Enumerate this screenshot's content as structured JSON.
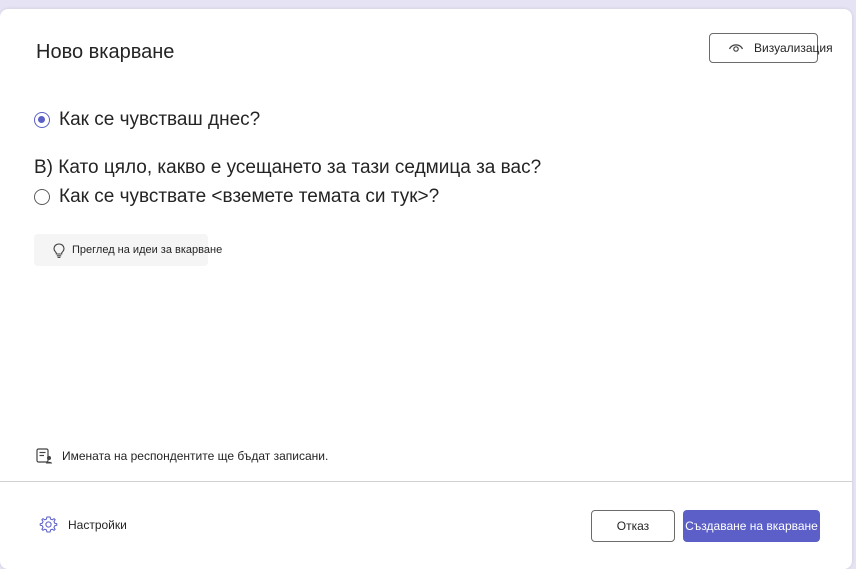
{
  "dialog": {
    "title": "Ново вкарване",
    "preview_label": "Визуализация"
  },
  "options": [
    {
      "label": "Как се чувстваш днес?",
      "selected": true
    },
    {
      "label": "Как се чувствате <вземете темата си тук>?",
      "selected": false
    }
  ],
  "question_text": "В) Като цяло, какво е усещането за тази седмица за вас?",
  "ideas_label": "Преглед на идеи за вкарване",
  "notice_text": "Имената на респондентите ще бъдат записани.",
  "footer": {
    "settings_label": "Настройки",
    "cancel_label": "Отказ",
    "create_label": "Създаване на вкарване"
  },
  "colors": {
    "accent": "#5b5fc7",
    "text": "#242424",
    "background": "#e6e4f4"
  },
  "icons": {
    "preview": "eye-icon",
    "ideas": "lightbulb-icon",
    "notice": "form-person-icon",
    "settings": "gear-icon"
  }
}
